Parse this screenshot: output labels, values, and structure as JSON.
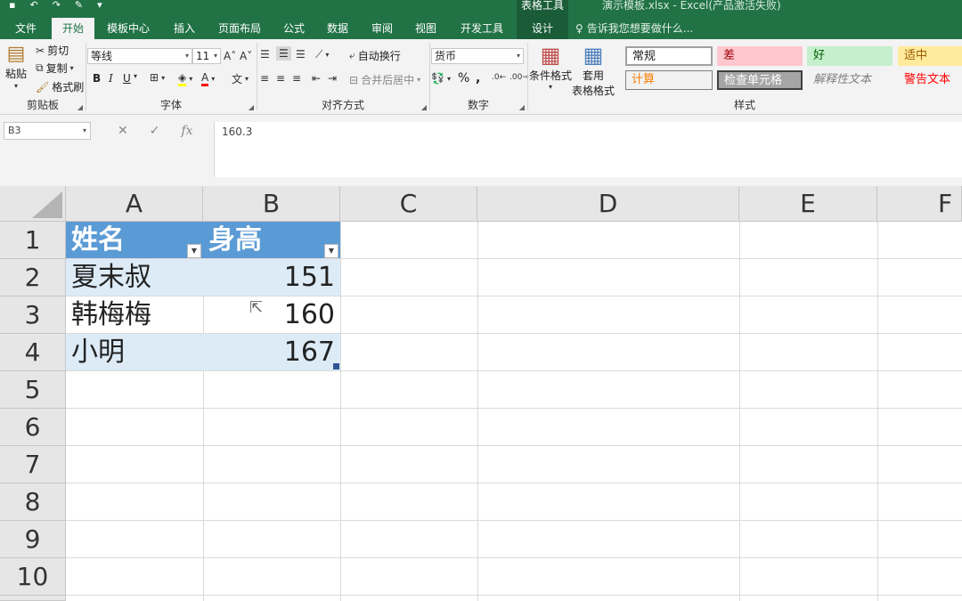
{
  "window": {
    "doc_title": "演示模板.xlsx - Excel(产品激活失败)",
    "context_tab_group": "表格工具",
    "tell_me": "告诉我您想要做什么..."
  },
  "tabs": [
    {
      "label": "文件",
      "active": false
    },
    {
      "label": "开始",
      "active": true
    },
    {
      "label": "模板中心",
      "active": false
    },
    {
      "label": "插入",
      "active": false
    },
    {
      "label": "页面布局",
      "active": false
    },
    {
      "label": "公式",
      "active": false
    },
    {
      "label": "数据",
      "active": false
    },
    {
      "label": "审阅",
      "active": false
    },
    {
      "label": "视图",
      "active": false
    },
    {
      "label": "开发工具",
      "active": false
    },
    {
      "label": "设计",
      "active": false
    }
  ],
  "ribbon": {
    "clipboard": {
      "paste": "粘贴",
      "cut": "剪切",
      "copy": "复制",
      "format_painter": "格式刷",
      "label": "剪贴板"
    },
    "font": {
      "font_name": "等线",
      "font_size": "11",
      "bold": "B",
      "italic": "I",
      "underline": "U",
      "label": "字体"
    },
    "alignment": {
      "wrap_text": "自动换行",
      "merge_center": "合并后居中",
      "label": "对齐方式"
    },
    "number": {
      "format": "货币",
      "percent": "%",
      "comma": ",",
      "label": "数字"
    },
    "styles": {
      "conditional": "条件格式",
      "format_table_1": "套用",
      "format_table_2": "表格格式",
      "label": "样式",
      "cells": [
        {
          "text": "常规",
          "color": "#000000",
          "bg": "#ffffff"
        },
        {
          "text": "差",
          "color": "#9c0006",
          "bg": "#ffc7ce"
        },
        {
          "text": "好",
          "color": "#006100",
          "bg": "#c6efce"
        },
        {
          "text": "适中",
          "color": "#9c5700",
          "bg": "#ffeb9c"
        },
        {
          "text": "计算",
          "color": "#fa7d00",
          "bg": "#f2f2f2"
        },
        {
          "text": "检查单元格",
          "color": "#ffffff",
          "bg": "#a5a5a5"
        },
        {
          "text": "解释性文本",
          "color": "#7f7f7f",
          "bg": "#f3f3f3"
        },
        {
          "text": "警告文本",
          "color": "#ff0000",
          "bg": "#f3f3f3"
        }
      ]
    }
  },
  "formula_bar": {
    "name_box": "B3",
    "cancel": "✕",
    "enter": "✓",
    "fx": "fx",
    "formula": "160.3"
  },
  "sheet": {
    "columns": [
      "A",
      "B",
      "C",
      "D",
      "E",
      "F"
    ],
    "rows": [
      "1",
      "2",
      "3",
      "4",
      "5",
      "6",
      "7",
      "8",
      "9",
      "10"
    ],
    "table_header": [
      "姓名",
      "身高"
    ],
    "table_rows": [
      [
        "夏末叔",
        "151"
      ],
      [
        "韩梅梅",
        "160"
      ],
      [
        "小明",
        "167"
      ]
    ]
  },
  "colors": {
    "excel_green": "#217346",
    "table_header": "#5b9bd5",
    "table_band": "#ddebf7"
  }
}
